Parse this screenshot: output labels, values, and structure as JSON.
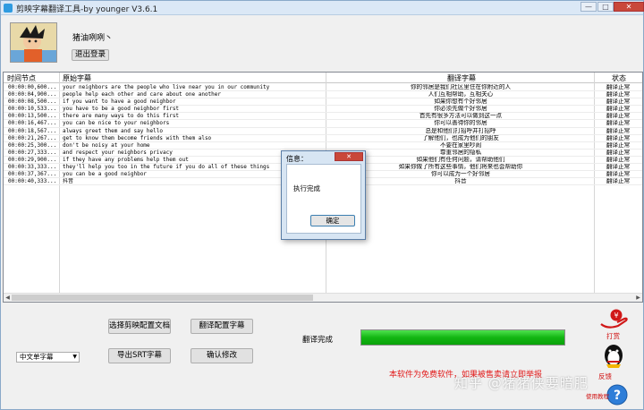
{
  "window": {
    "title": "剪映字幕翻译工具-by younger V3.6.1",
    "controls": {
      "minimize": "—",
      "maximize": "□",
      "close": "✕"
    }
  },
  "user": {
    "name": "猪油咧咧丶",
    "logout_label": "退出登录"
  },
  "table": {
    "columns": [
      "时间节点",
      "原始字幕",
      "翻译字幕",
      "状态"
    ],
    "rows": [
      {
        "time": "00:00:00,600...",
        "original": "your neighbors are the people who live near you in our community",
        "translated": "你的邻居是我们社区里住在你附近的人",
        "status": "翻译正常"
      },
      {
        "time": "00:00:04,900...",
        "original": "people help each other and care about one another",
        "translated": "人们互相帮助，互相关心",
        "status": "翻译正常"
      },
      {
        "time": "00:00:08,500...",
        "original": "if you want to have a good neighbor",
        "translated": "如果你想有个好邻居",
        "status": "翻译正常"
      },
      {
        "time": "00:00:10,533...",
        "original": "you have to be a good neighbor first",
        "translated": "你必须先做个好邻居",
        "status": "翻译正常"
      },
      {
        "time": "00:00:13,500...",
        "original": "there are many ways to do this first",
        "translated": "首先有很多方法可以做到这一点",
        "status": "翻译正常"
      },
      {
        "time": "00:00:16,467...",
        "original": "you can be nice to your neighbors",
        "translated": "你可以善待你的邻居",
        "status": "翻译正常"
      },
      {
        "time": "00:00:18,567...",
        "original": "always greet them and say hello",
        "translated": "总是和他们打招呼并打招呼",
        "status": "翻译正常"
      },
      {
        "time": "00:00:21,267...",
        "original": "get to know them become friends with them also",
        "translated": "了解他们，也成为他们的朋友",
        "status": "翻译正常"
      },
      {
        "time": "00:00:25,300...",
        "original": "don't be noisy at your home",
        "translated": "不要在家里吵闹",
        "status": "翻译正常"
      },
      {
        "time": "00:00:27,333...",
        "original": "and respect your neighbors privacy",
        "translated": "尊重邻居的隐私",
        "status": "翻译正常"
      },
      {
        "time": "00:00:29,900...",
        "original": "if they have any problems help them out",
        "translated": "如果他们有任何问题，请帮助他们",
        "status": "翻译正常"
      },
      {
        "time": "00:00:33,333...",
        "original": "they'll help you too in the future if you do all of these things",
        "translated": "如果你做了所有这些事情，他们将来也会帮助你",
        "status": "翻译正常"
      },
      {
        "time": "00:00:37,367...",
        "original": "you can be a good neighbor",
        "translated": "你可以成为一个好邻居",
        "status": "翻译正常"
      },
      {
        "time": "00:00:40,333...",
        "original": "抖音",
        "translated": "抖音",
        "status": "翻译正常"
      }
    ]
  },
  "controls": {
    "select_config_doc": "选择剪映配置文档",
    "translate_config": "翻译配置字幕",
    "export_srt": "导出SRT字幕",
    "confirm_modify": "确认修改",
    "language_selected": "中文单字幕"
  },
  "status": {
    "label": "翻译完成",
    "progress_percent": 100
  },
  "notice": "本软件为免费软件，如果被售卖请立即举报",
  "watermark": "知乎 @猪猪侠要暗肥",
  "side": {
    "tip_label": "打赏",
    "feedback_label": "反馈",
    "tutorial_label": "使用教程"
  },
  "dialog": {
    "title": "信息：",
    "message": "执行完成",
    "ok_label": "确定",
    "close_label": "✕"
  },
  "colors": {
    "progress_green": "#13b613",
    "notice_red": "#e21a1a",
    "close_red": "#c9483a"
  }
}
